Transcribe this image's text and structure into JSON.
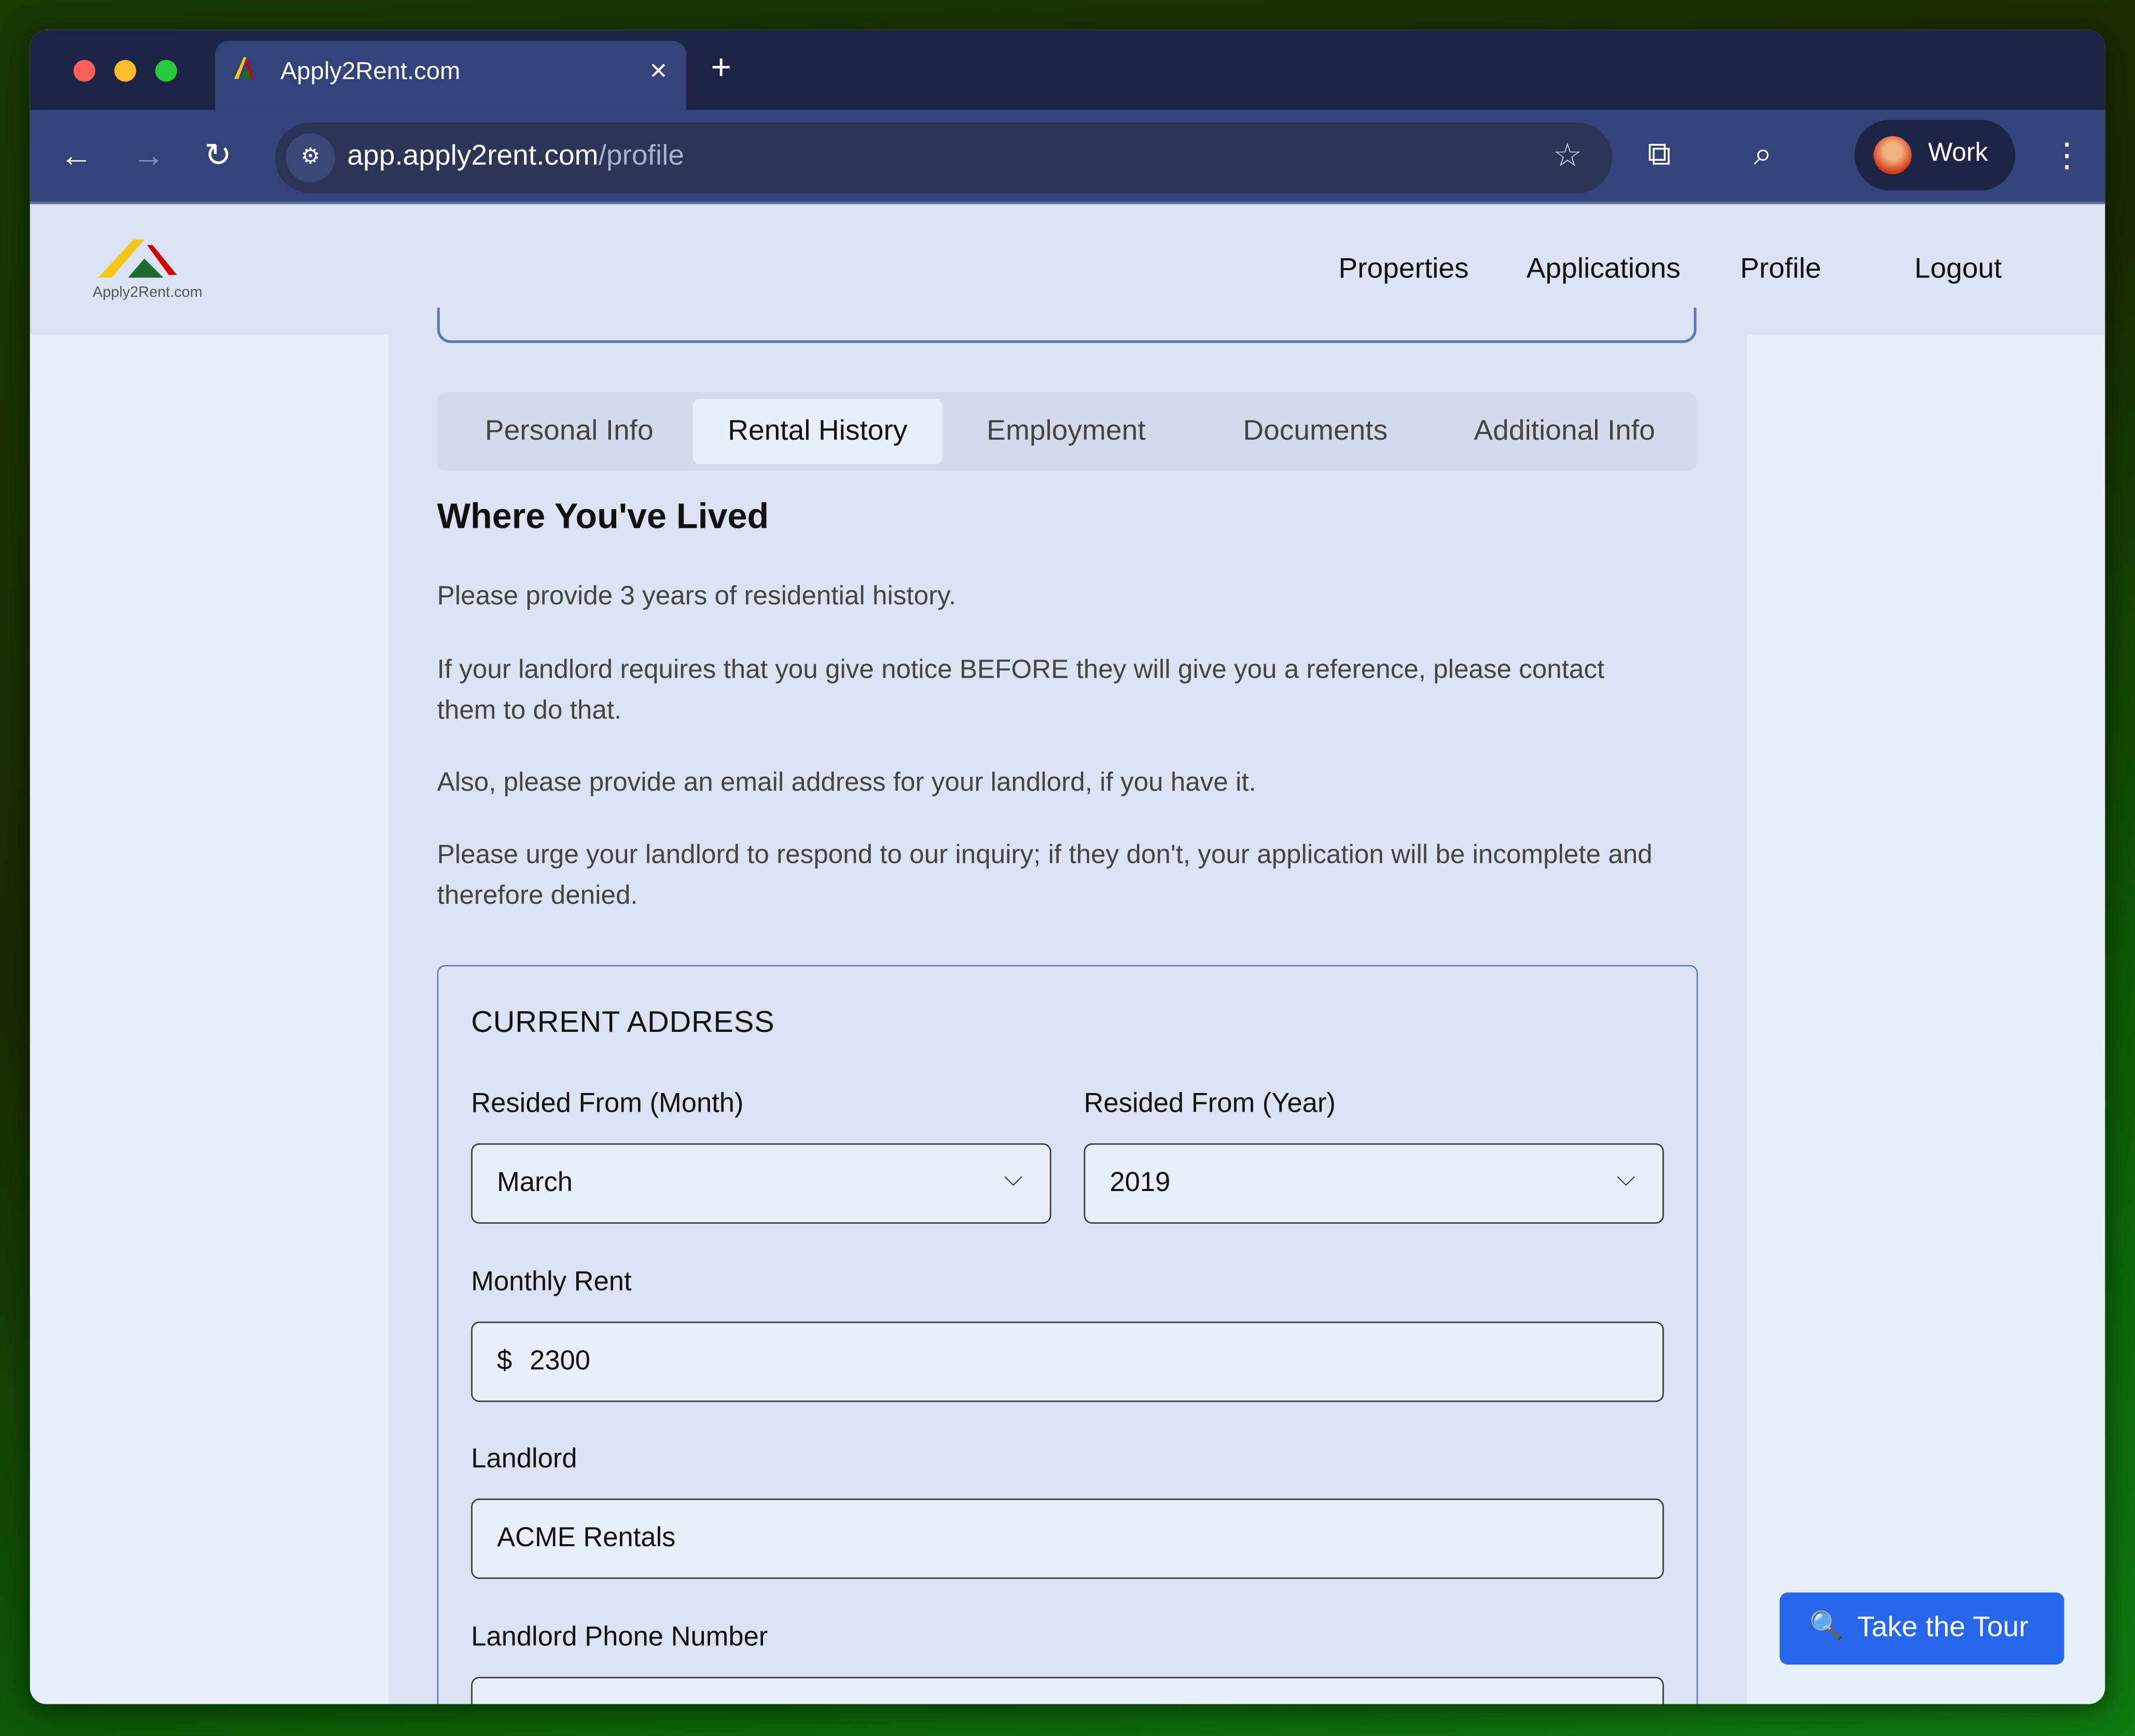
{
  "browser": {
    "tab_title": "Apply2Rent.com",
    "url_host": "app.apply2rent.com",
    "url_path": "/profile",
    "profile_name": "Work"
  },
  "header": {
    "logo_text": "Apply2Rent.com",
    "nav": [
      "Properties",
      "Applications",
      "Profile",
      "Logout"
    ]
  },
  "tabs": [
    {
      "label": "Personal Info",
      "active": false
    },
    {
      "label": "Rental History",
      "active": true
    },
    {
      "label": "Employment",
      "active": false
    },
    {
      "label": "Documents",
      "active": false
    },
    {
      "label": "Additional Info",
      "active": false
    }
  ],
  "section": {
    "title": "Where You've Lived",
    "paragraphs": [
      "Please provide 3 years of residential history.",
      "If your landlord requires that you give notice BEFORE they will give you a reference, please contact them to do that.",
      "Also, please provide an email address for your landlord, if you have it.",
      "Please urge your landlord to respond to our inquiry; if they don't, your application will be incomplete and therefore denied."
    ]
  },
  "card": {
    "title": "CURRENT ADDRESS",
    "month_label": "Resided From (Month)",
    "month_value": "March",
    "year_label": "Resided From (Year)",
    "year_value": "2019",
    "rent_label": "Monthly Rent",
    "rent_prefix": "$",
    "rent_value": "2300",
    "landlord_label": "Landlord",
    "landlord_value": "ACME Rentals",
    "phone_label": "Landlord Phone Number",
    "phone_value": ""
  },
  "tour_button": "Take the Tour",
  "colors": {
    "accent": "#2667eb",
    "tab_bar": "#1e2444",
    "toolbar": "#34437a"
  }
}
